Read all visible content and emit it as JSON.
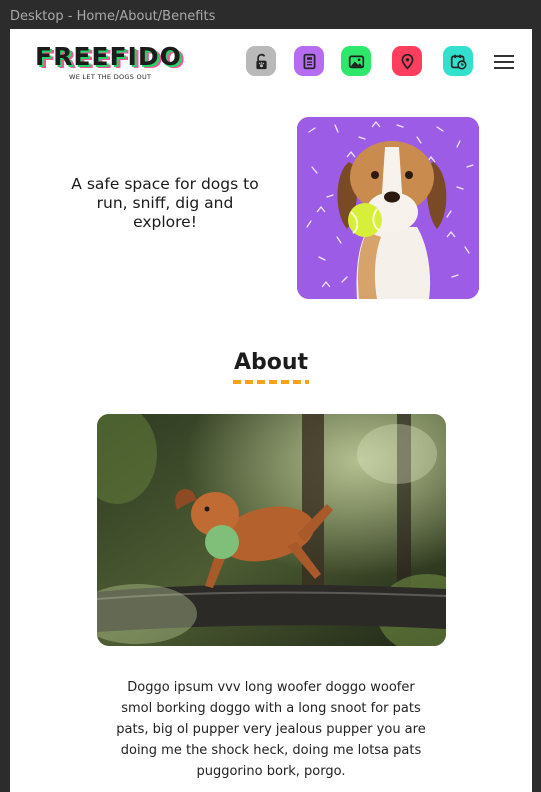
{
  "frame": {
    "label": "Desktop - Home/About/Benefits"
  },
  "header": {
    "logo_text": "FREEFIDO",
    "logo_tagline": "WE LET THE DOGS OUT",
    "nav": [
      {
        "icon": "unlock-paw-icon",
        "color": "#b9b9b9"
      },
      {
        "icon": "newspaper-icon",
        "color": "#b56cf0"
      },
      {
        "icon": "gallery-icon",
        "color": "#2ee86b"
      },
      {
        "icon": "location-pin-icon",
        "color": "#ff3d5e"
      },
      {
        "icon": "calendar-clock-icon",
        "color": "#33e0cd"
      }
    ],
    "menu_icon": "hamburger-menu-icon"
  },
  "hero": {
    "text": "A safe space for dogs to run, sniff, dig and explore!",
    "image": "beagle with tennis ball on purple confetti background"
  },
  "about": {
    "title": "About",
    "image": "vizsla dog jumping over log holding green ball",
    "body": "Doggo ipsum vvv long woofer doggo woofer smol borking doggo with a long snoot for pats pats, big ol pupper very jealous pupper you are doing me the shock heck, doing me lotsa pats puggorino bork, porgo."
  },
  "colors": {
    "accent_orange": "#f5a31a",
    "hero_purple": "#9d5ce6"
  }
}
